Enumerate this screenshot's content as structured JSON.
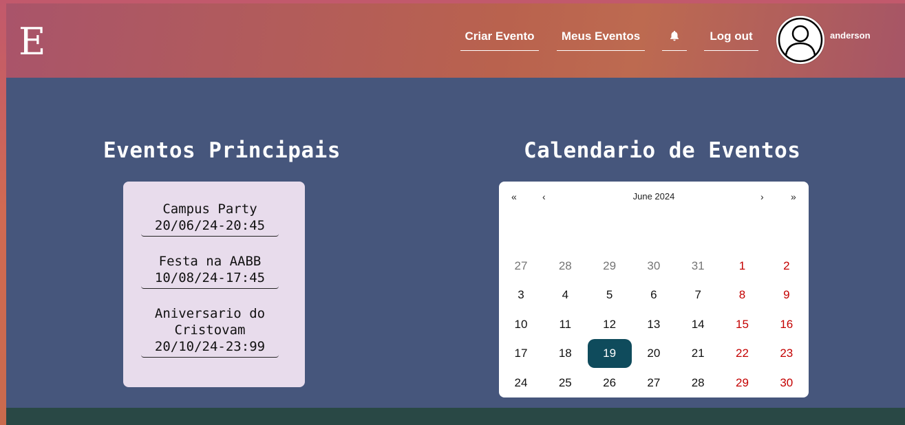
{
  "header": {
    "logo": "E",
    "nav": [
      "Criar Evento",
      "Meus Eventos",
      "Log out"
    ],
    "bell_icon": "bell-icon",
    "avatar_icon": "user-avatar-icon",
    "username": "anderson"
  },
  "main": {
    "events_title": "Eventos Principais",
    "events": [
      {
        "name": "Campus Party",
        "datetime": "20/06/24-20:45"
      },
      {
        "name": "Festa na AABB",
        "datetime": "10/08/24-17:45"
      },
      {
        "name": "Aniversario do Cristovam",
        "datetime": "20/10/24-23:99"
      }
    ],
    "calendar_title": "Calendario de Eventos"
  },
  "calendar": {
    "label": "June 2024",
    "nav": {
      "prev2": "«",
      "prev": "‹",
      "next": "›",
      "next2": "»"
    },
    "selected_day": "19",
    "weeks": [
      [
        "27",
        "28",
        "29",
        "30",
        "31",
        "1",
        "2"
      ],
      [
        "3",
        "4",
        "5",
        "6",
        "7",
        "8",
        "9"
      ],
      [
        "10",
        "11",
        "12",
        "13",
        "14",
        "15",
        "16"
      ],
      [
        "17",
        "18",
        "19",
        "20",
        "21",
        "22",
        "23"
      ],
      [
        "24",
        "25",
        "26",
        "27",
        "28",
        "29",
        "30"
      ]
    ]
  },
  "colors": {
    "selected_day": "#0f4b5c",
    "weekend": "#c40000",
    "page_bg": "#46567c",
    "footer": "#294845"
  }
}
